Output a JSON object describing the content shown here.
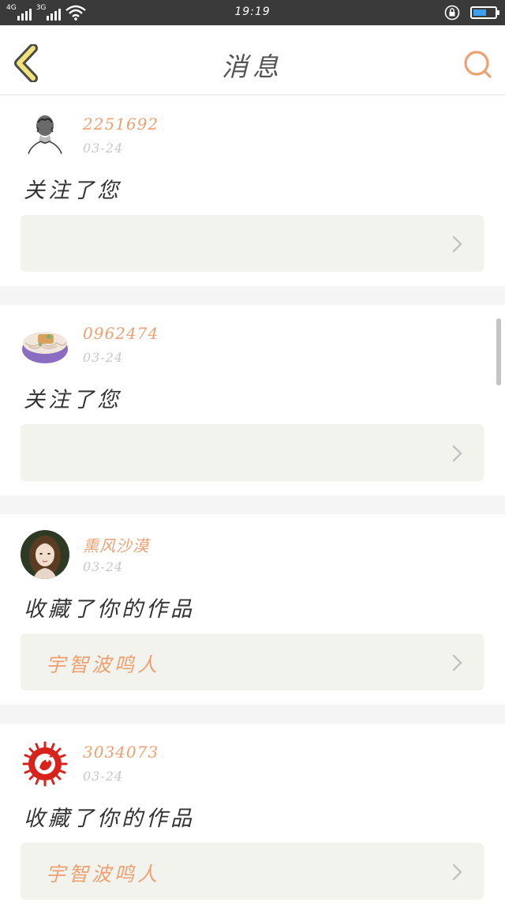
{
  "status_bar": {
    "net1": "4G",
    "net2": "3G",
    "time": "19:19",
    "battery_level": 0.6
  },
  "header": {
    "title": "消息",
    "back_icon": "chevron-left-icon",
    "search_icon": "search-icon"
  },
  "messages": [
    {
      "avatar": "sketch-portrait",
      "username": "2251692",
      "date": "03-24",
      "action": "关注了您",
      "link_text": ""
    },
    {
      "avatar": "noodle-bowl",
      "username": "0962474",
      "date": "03-24",
      "action": "关注了您",
      "link_text": ""
    },
    {
      "avatar": "girl-portrait",
      "username": "熏风沙漠",
      "date": "03-24",
      "action": "收藏了你的作品",
      "link_text": "宇智波鸣人"
    },
    {
      "avatar": "red-papercut",
      "username": "3034073",
      "date": "03-24",
      "action": "收藏了你的作品",
      "link_text": "宇智波鸣人"
    }
  ],
  "colors": {
    "accent": "#f0a070",
    "status_bar_bg": "#3a3a3a",
    "battery": "#3d9ef2",
    "link_box_bg": "#f3f3ee",
    "separator": "#f6f5f6"
  }
}
